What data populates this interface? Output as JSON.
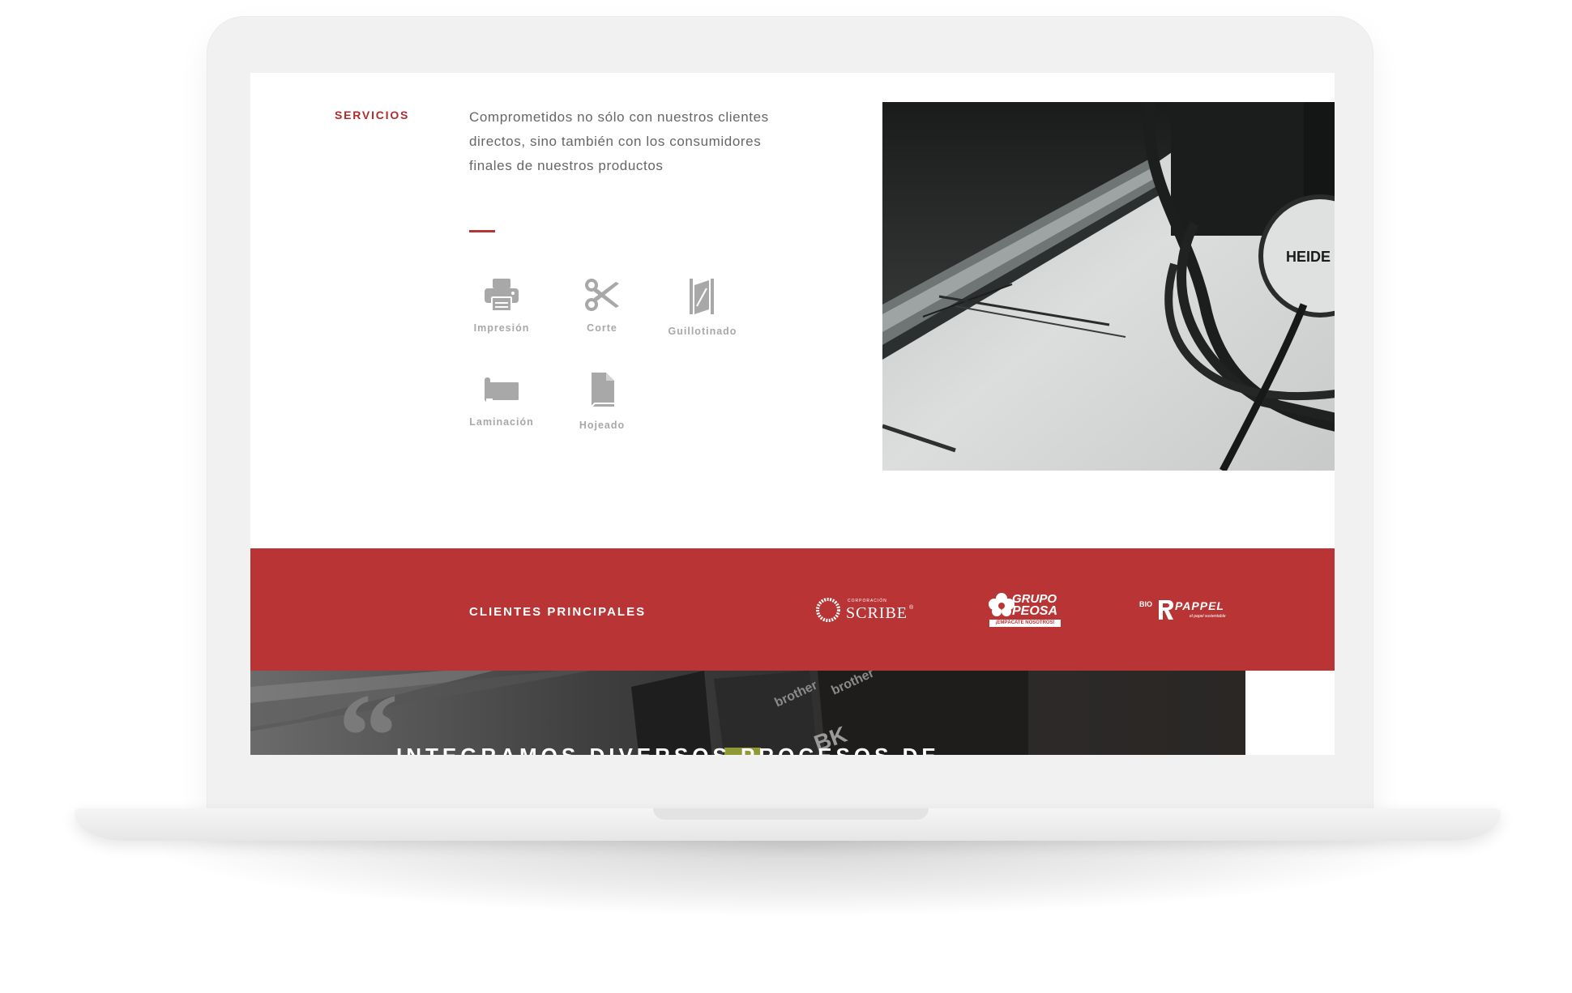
{
  "services_section": {
    "label": "SERVICIOS",
    "intro": "Comprometidos no sólo con nuestros clientes directos, sino también con los consumidores finales de nuestros productos",
    "items": [
      {
        "label": "Impresión",
        "icon": "printer-icon"
      },
      {
        "label": "Corte",
        "icon": "scissors-icon"
      },
      {
        "label": "Guillotinado",
        "icon": "guillotine-icon"
      },
      {
        "label": "Laminación",
        "icon": "lamination-icon"
      },
      {
        "label": "Hojeado",
        "icon": "sheet-icon"
      }
    ]
  },
  "photo": {
    "brand_text": "HEIDE"
  },
  "clients_section": {
    "title": "CLIENTES PRINCIPALES",
    "logos": [
      {
        "small_text": "CORPORACIÓN",
        "name": "SCRIBE",
        "mark": "®"
      },
      {
        "line1": "GRUPO",
        "line2": "PEOSA",
        "tagline": "¡EMPÁCATE NOSOTROS!"
      },
      {
        "prefix": "BIO",
        "name": "PAPPEL",
        "tagline": "el papel sustentable"
      }
    ]
  },
  "quote_section": {
    "text": "INTEGRAMOS DIVERSOS PROCESOS DE",
    "quote_mark": "“",
    "printer_labels": [
      "brother",
      "brother",
      "BK"
    ]
  },
  "colors": {
    "brand_red": "#b93535",
    "icon_gray": "#a8a8a8",
    "text_gray": "#666666"
  }
}
